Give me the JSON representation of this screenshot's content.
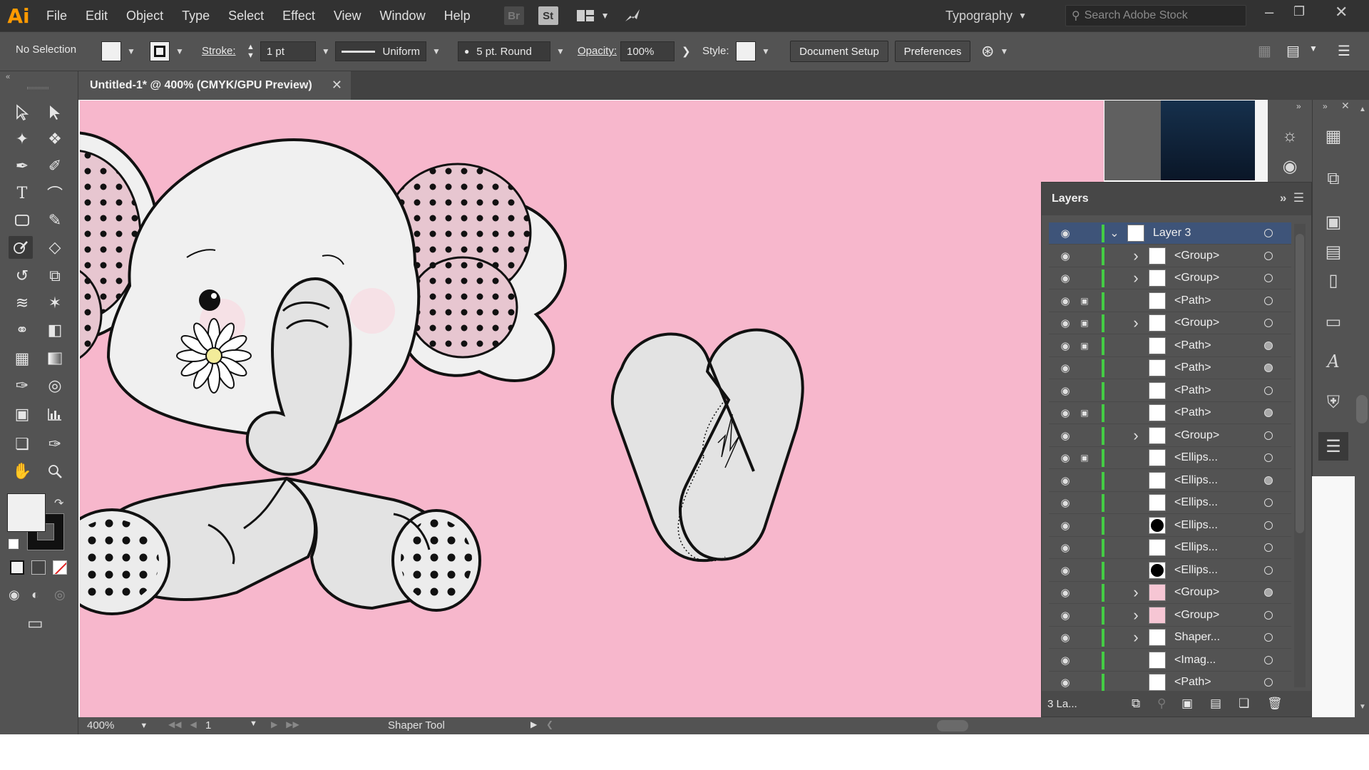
{
  "app": {
    "logo": "Ai"
  },
  "menu": [
    "File",
    "Edit",
    "Object",
    "Type",
    "Select",
    "Effect",
    "View",
    "Window",
    "Help"
  ],
  "menubar_icons": {
    "bridge": "Br",
    "stock": "St"
  },
  "workspace": {
    "label": "Typography"
  },
  "search": {
    "placeholder": "Search Adobe Stock"
  },
  "control_bar": {
    "selection": "No Selection",
    "stroke_label": "Stroke:",
    "stroke_weight": "1 pt",
    "profile": "Uniform",
    "brush": "5 pt. Round",
    "opacity_label": "Opacity:",
    "opacity_value": "100%",
    "style_label": "Style:",
    "document_setup": "Document Setup",
    "preferences": "Preferences"
  },
  "document": {
    "tab_title": "Untitled-1* @ 400% (CMYK/GPU Preview)"
  },
  "canvas": {
    "background": "#f7b7cc"
  },
  "layers_panel": {
    "title": "Layers",
    "rows": [
      {
        "name": "Layer 3",
        "lock": false,
        "expand": "open",
        "target": "hollow",
        "selected": true
      },
      {
        "name": "<Group>",
        "lock": false,
        "expand": "closed",
        "target": "hollow"
      },
      {
        "name": "<Group>",
        "lock": false,
        "expand": "closed",
        "target": "hollow"
      },
      {
        "name": "<Path>",
        "lock": true,
        "expand": "none",
        "target": "hollow"
      },
      {
        "name": "<Group>",
        "lock": true,
        "expand": "closed",
        "target": "hollow"
      },
      {
        "name": "<Path>",
        "lock": true,
        "expand": "none",
        "target": "filled"
      },
      {
        "name": "<Path>",
        "lock": false,
        "expand": "none",
        "target": "filled"
      },
      {
        "name": "<Path>",
        "lock": false,
        "expand": "none",
        "target": "hollow"
      },
      {
        "name": "<Path>",
        "lock": true,
        "expand": "none",
        "target": "filled"
      },
      {
        "name": "<Group>",
        "lock": false,
        "expand": "closed",
        "target": "hollow"
      },
      {
        "name": "<Ellips...",
        "lock": true,
        "expand": "none",
        "target": "hollow"
      },
      {
        "name": "<Ellips...",
        "lock": false,
        "expand": "none",
        "target": "filled"
      },
      {
        "name": "<Ellips...",
        "lock": false,
        "expand": "none",
        "target": "hollow"
      },
      {
        "name": "<Ellips...",
        "lock": false,
        "expand": "none",
        "target": "hollow",
        "thumb": "black"
      },
      {
        "name": "<Ellips...",
        "lock": false,
        "expand": "none",
        "target": "hollow"
      },
      {
        "name": "<Ellips...",
        "lock": false,
        "expand": "none",
        "target": "hollow",
        "thumb": "black"
      },
      {
        "name": "<Group>",
        "lock": false,
        "expand": "closed",
        "target": "filled",
        "thumb": "pink"
      },
      {
        "name": "<Group>",
        "lock": false,
        "expand": "closed",
        "target": "hollow",
        "thumb": "pink"
      },
      {
        "name": "Shaper...",
        "lock": false,
        "expand": "closed",
        "target": "hollow"
      },
      {
        "name": "<Imag...",
        "lock": false,
        "expand": "none",
        "target": "hollow"
      },
      {
        "name": "<Path>",
        "lock": false,
        "expand": "none",
        "target": "hollow"
      }
    ],
    "footer_count": "3 La..."
  },
  "status_bar": {
    "zoom": "400%",
    "artboard": "1",
    "tool": "Shaper Tool"
  },
  "icons": {
    "eye": "visibility-eye-icon",
    "lock": "lock-icon",
    "chevron": "chevron-icon"
  }
}
